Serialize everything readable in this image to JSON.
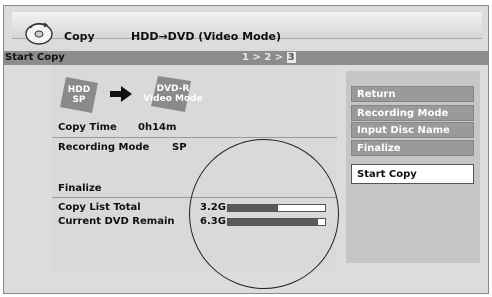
{
  "header": {
    "title": "Copy",
    "mode": "HDD→DVD (Video Mode)"
  },
  "subheader": {
    "label": "Start Copy",
    "step1": "1 > ",
    "step2": "2 > ",
    "step3": "3"
  },
  "source": {
    "line1": "HDD",
    "line2": "SP"
  },
  "destination": {
    "line1": "DVD-R",
    "line2": "Video Mode"
  },
  "info": {
    "copy_time_label": "Copy Time",
    "copy_time_value": "0h14m",
    "recording_mode_label": "Recording Mode",
    "recording_mode_value": "SP",
    "finalize_label": "Finalize",
    "copy_list_total_label": "Copy List Total",
    "copy_list_total_value": "3.2G",
    "copy_list_total_fill": 0.52,
    "dvd_remain_label": "Current DVD Remain",
    "dvd_remain_value": "6.3G",
    "dvd_remain_fill": 0.93
  },
  "menu": {
    "items": [
      "Return",
      "Recording Mode",
      "Input Disc Name",
      "Finalize",
      "Start Copy"
    ],
    "selected": "Start Copy"
  },
  "colors": {
    "bar_fill": "#5a5a5a",
    "menu_item": "#9a9a9a",
    "menu_selected": "#ffffff"
  }
}
